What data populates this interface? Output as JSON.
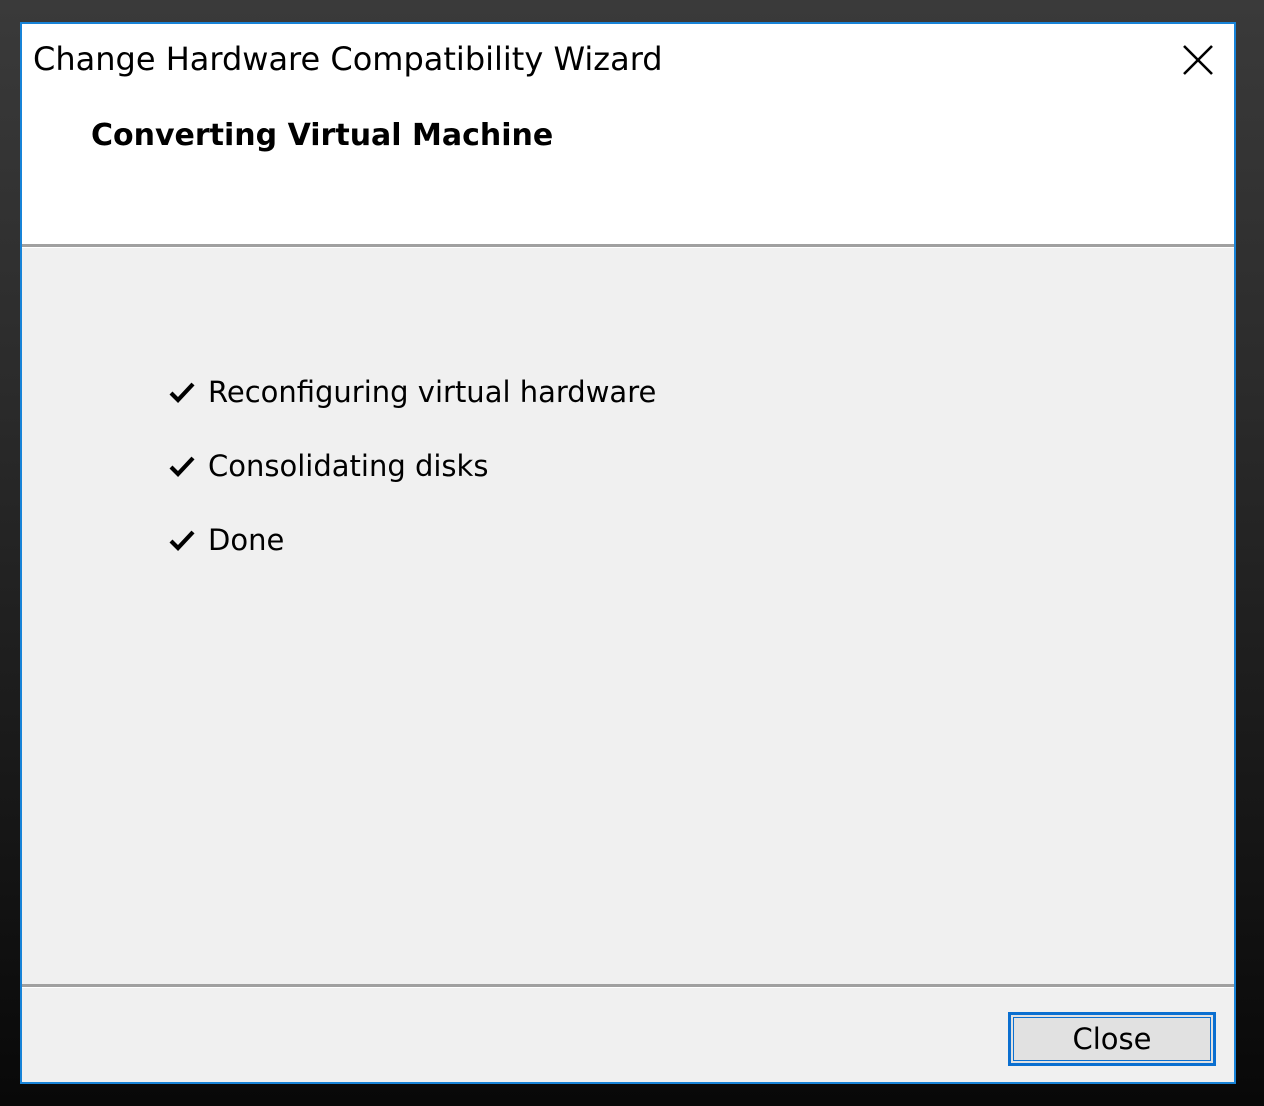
{
  "window": {
    "title": "Change Hardware Compatibility Wizard",
    "accent_color": "#1883d7"
  },
  "header": {
    "title": "Converting Virtual Machine"
  },
  "steps": [
    {
      "label": "Reconfiguring virtual hardware",
      "status": "complete",
      "icon": "checkmark-icon"
    },
    {
      "label": "Consolidating disks",
      "status": "complete",
      "icon": "checkmark-icon"
    },
    {
      "label": "Done",
      "status": "complete",
      "icon": "checkmark-icon"
    }
  ],
  "footer": {
    "close_label": "Close"
  },
  "icons": {
    "title_close": "close-icon"
  }
}
